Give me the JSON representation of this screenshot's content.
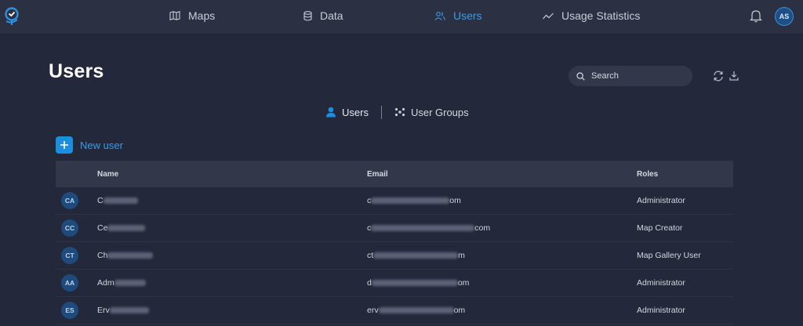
{
  "nav": {
    "items": [
      {
        "label": "Maps",
        "icon": "map-icon",
        "active": false
      },
      {
        "label": "Data",
        "icon": "database-icon",
        "active": false
      },
      {
        "label": "Users",
        "icon": "users-icon",
        "active": true
      },
      {
        "label": "Usage Statistics",
        "icon": "chart-line-icon",
        "active": false
      }
    ],
    "avatar_initials": "AS"
  },
  "page": {
    "title": "Users",
    "search_placeholder": "Search"
  },
  "subtabs": [
    {
      "label": "Users",
      "active": true
    },
    {
      "label": "User Groups",
      "active": false
    }
  ],
  "new_user_label": "New user",
  "table": {
    "columns": [
      "Name",
      "Email",
      "Roles"
    ],
    "rows": [
      {
        "initials": "CA",
        "name_visible": "C",
        "email_visible_start": "c",
        "email_visible_end": "om",
        "role": "Administrator"
      },
      {
        "initials": "CC",
        "name_visible": "Ce",
        "email_visible_start": "c",
        "email_visible_end": "com",
        "role": "Map Creator"
      },
      {
        "initials": "CT",
        "name_visible": "Ch",
        "email_visible_start": "ct",
        "email_visible_end": "m",
        "role": "Map Gallery User"
      },
      {
        "initials": "AA",
        "name_visible": "Adm",
        "email_visible_start": "d",
        "email_visible_end": "om",
        "role": "Administrator"
      },
      {
        "initials": "ES",
        "name_visible": "Erv",
        "email_visible_start": "erv",
        "email_visible_end": "om",
        "role": "Administrator"
      }
    ]
  },
  "colors": {
    "accent": "#3a9be8",
    "background": "#23283a",
    "topbar": "#2b3143"
  }
}
